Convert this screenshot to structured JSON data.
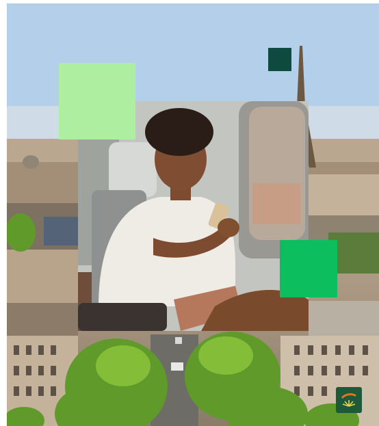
{
  "images": {
    "background": "paris-cityscape-with-eiffel-tower",
    "foreground": "woman-using-phone-on-train"
  },
  "colors": {
    "square_light": "#aeeea0",
    "square_dark": "#0f4a3e",
    "square_mid": "#0dbe5e",
    "logo_bg": "#1d5a3a"
  },
  "logo": {
    "icon": "brand-logo-icon"
  }
}
